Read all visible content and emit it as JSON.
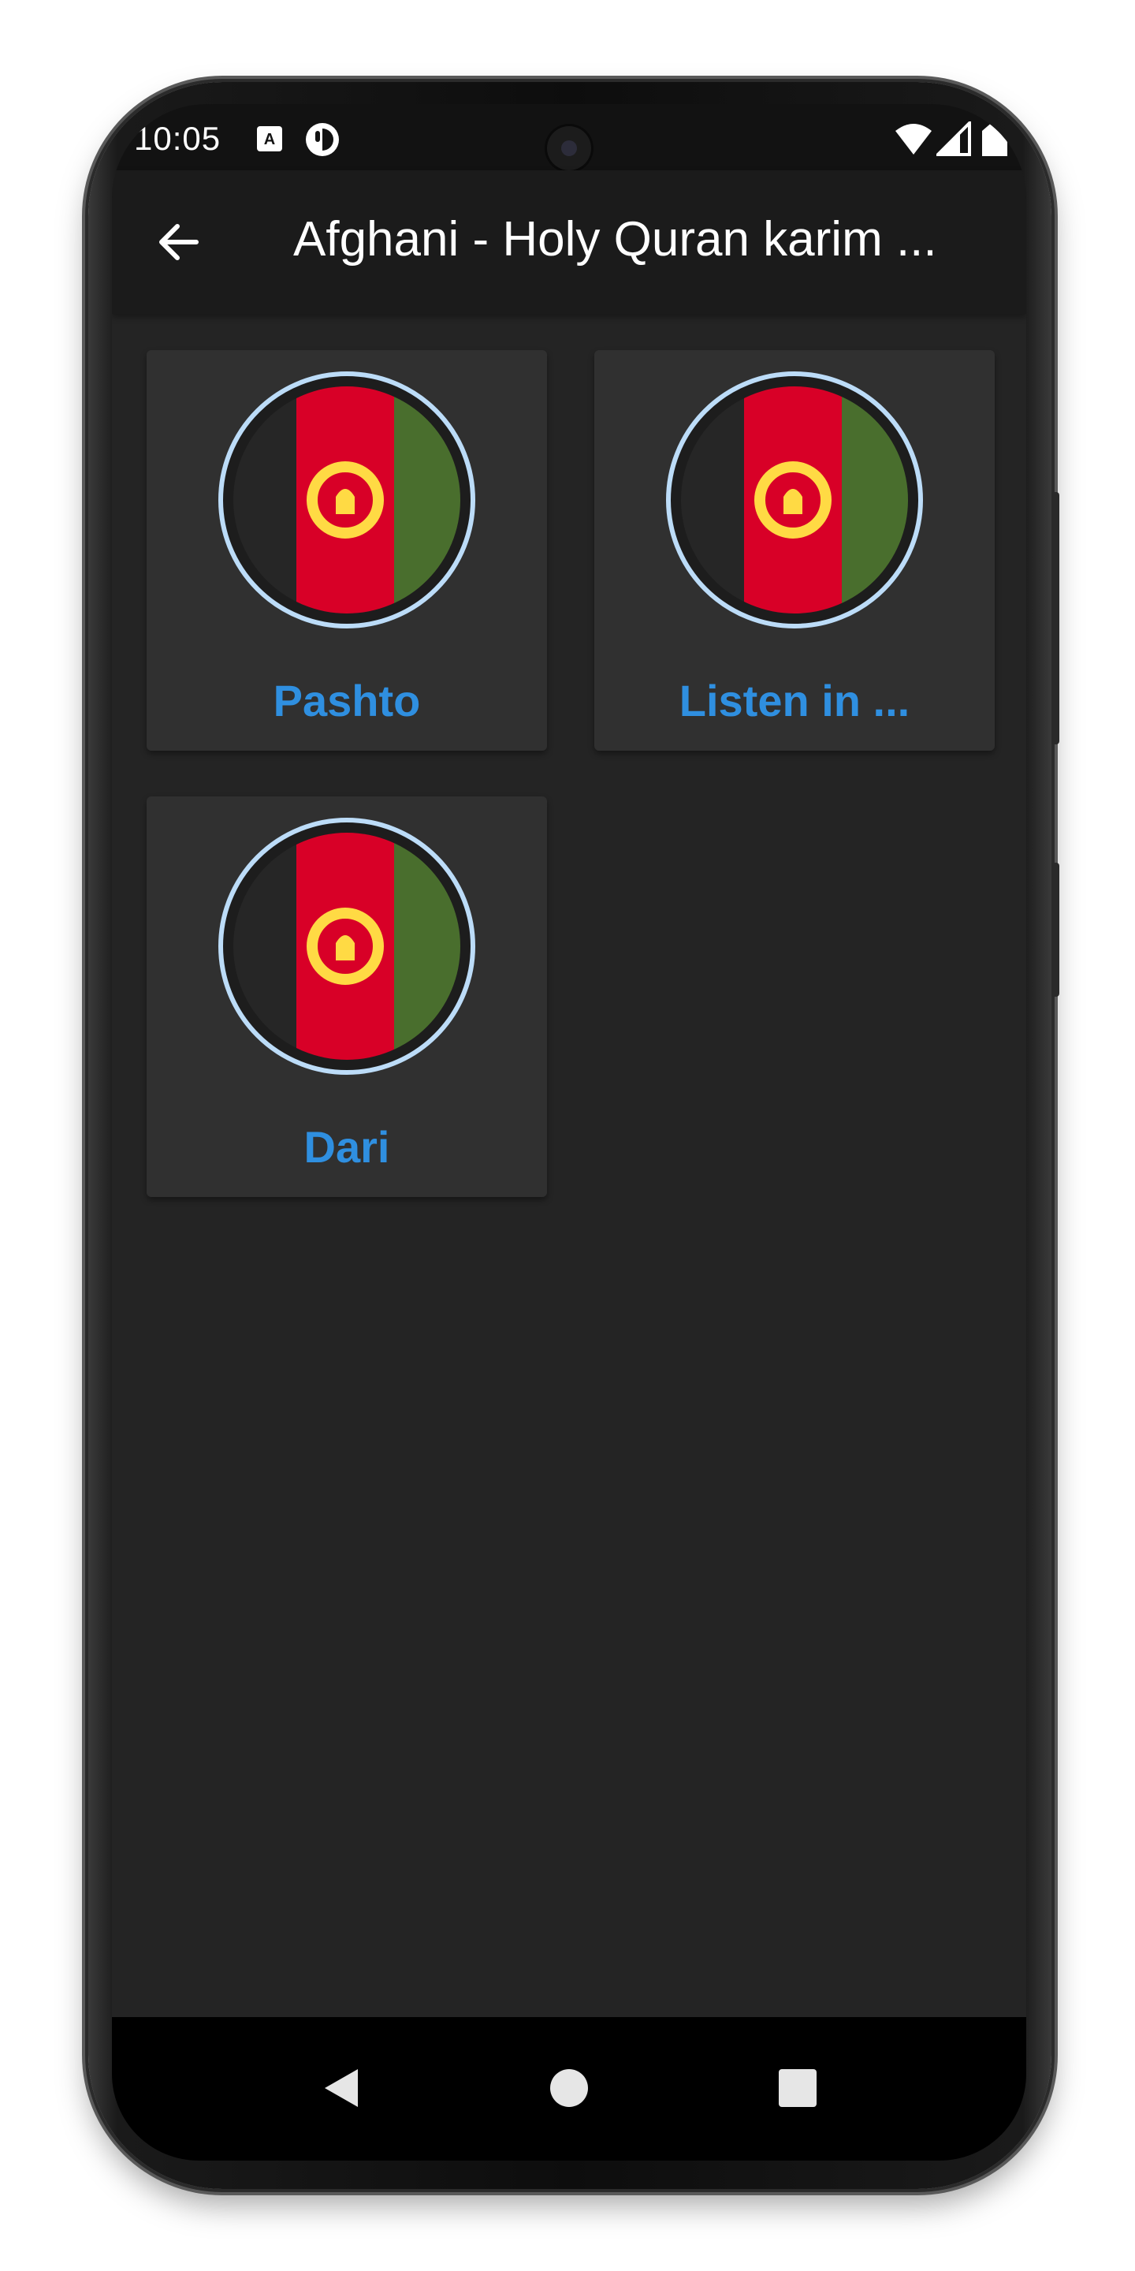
{
  "status_bar": {
    "time": "10:05",
    "icons": [
      "a-badge-icon",
      "circle-app-icon",
      "wifi-icon",
      "signal-icon",
      "battery-icon"
    ]
  },
  "app_bar": {
    "title": "Afghani - Holy Quran karim ...",
    "back_icon": "arrow-left-icon"
  },
  "items": [
    {
      "label": "Pashto",
      "flag": "afghanistan-flag-icon"
    },
    {
      "label": "Listen in ...",
      "flag": "afghanistan-flag-icon"
    },
    {
      "label": "Dari",
      "flag": "afghanistan-flag-icon"
    }
  ],
  "nav_bar": {
    "icons": [
      "back-triangle-icon",
      "home-circle-icon",
      "recents-square-icon"
    ]
  },
  "colors": {
    "background": "#242424",
    "card": "#303030",
    "label_accent": "#2f8fe0",
    "flag_red": "#d80027",
    "flag_green": "#496e2d",
    "flag_yellow": "#ffda44",
    "flag_ring": "#bcdcf8"
  }
}
